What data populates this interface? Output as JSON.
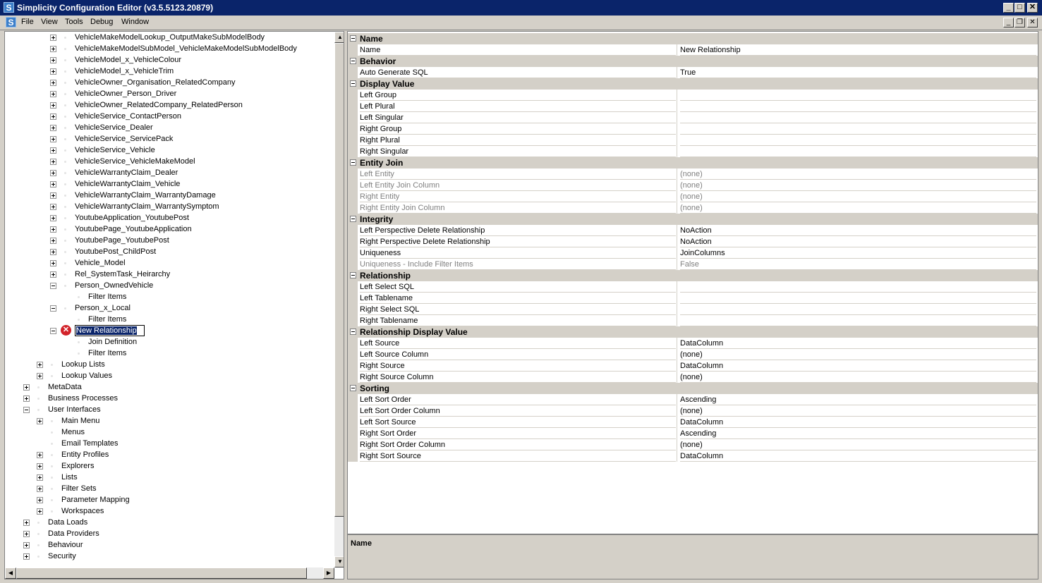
{
  "window": {
    "title": "Simplicity Configuration Editor (v3.5.5123.20879)",
    "minimize": "_",
    "maximize": "□",
    "close": "✕"
  },
  "menu": {
    "items": [
      "File",
      "View",
      "Tools",
      "Debug",
      "Window"
    ]
  },
  "tree": {
    "nodes": [
      {
        "label": "VehicleMakeModelLookup_OutputMakeSubModelBody",
        "level": 3,
        "exp": "plus"
      },
      {
        "label": "VehicleMakeModelSubModel_VehicleMakeModelSubModelBody",
        "level": 3,
        "exp": "plus"
      },
      {
        "label": "VehicleModel_x_VehicleColour",
        "level": 3,
        "exp": "plus"
      },
      {
        "label": "VehicleModel_x_VehicleTrim",
        "level": 3,
        "exp": "plus"
      },
      {
        "label": "VehicleOwner_Organisation_RelatedCompany",
        "level": 3,
        "exp": "plus"
      },
      {
        "label": "VehicleOwner_Person_Driver",
        "level": 3,
        "exp": "plus"
      },
      {
        "label": "VehicleOwner_RelatedCompany_RelatedPerson",
        "level": 3,
        "exp": "plus"
      },
      {
        "label": "VehicleService_ContactPerson",
        "level": 3,
        "exp": "plus"
      },
      {
        "label": "VehicleService_Dealer",
        "level": 3,
        "exp": "plus"
      },
      {
        "label": "VehicleService_ServicePack",
        "level": 3,
        "exp": "plus"
      },
      {
        "label": "VehicleService_Vehicle",
        "level": 3,
        "exp": "plus"
      },
      {
        "label": "VehicleService_VehicleMakeModel",
        "level": 3,
        "exp": "plus"
      },
      {
        "label": "VehicleWarrantyClaim_Dealer",
        "level": 3,
        "exp": "plus"
      },
      {
        "label": "VehicleWarrantyClaim_Vehicle",
        "level": 3,
        "exp": "plus"
      },
      {
        "label": "VehicleWarrantyClaim_WarrantyDamage",
        "level": 3,
        "exp": "plus"
      },
      {
        "label": "VehicleWarrantyClaim_WarrantySymptom",
        "level": 3,
        "exp": "plus"
      },
      {
        "label": "YoutubeApplication_YoutubePost",
        "level": 3,
        "exp": "plus"
      },
      {
        "label": "YoutubePage_YoutubeApplication",
        "level": 3,
        "exp": "plus"
      },
      {
        "label": "YoutubePage_YoutubePost",
        "level": 3,
        "exp": "plus"
      },
      {
        "label": "YoutubePost_ChildPost",
        "level": 3,
        "exp": "plus"
      },
      {
        "label": "Vehicle_Model",
        "level": 3,
        "exp": "plus"
      },
      {
        "label": "Rel_SystemTask_Heirarchy",
        "level": 3,
        "exp": "plus"
      },
      {
        "label": "Person_OwnedVehicle",
        "level": 3,
        "exp": "minus"
      },
      {
        "label": "Filter Items",
        "level": 4,
        "exp": "none"
      },
      {
        "label": "Person_x_Local",
        "level": 3,
        "exp": "minus"
      },
      {
        "label": "Filter Items",
        "level": 4,
        "exp": "none"
      },
      {
        "label": "New Relationship",
        "level": 3,
        "exp": "minus",
        "error": true,
        "editing": true
      },
      {
        "label": "Join Definition",
        "level": 4,
        "exp": "none"
      },
      {
        "label": "Filter Items",
        "level": 4,
        "exp": "none"
      },
      {
        "label": "Lookup Lists",
        "level": 2,
        "exp": "plus"
      },
      {
        "label": "Lookup Values",
        "level": 2,
        "exp": "plus"
      },
      {
        "label": "MetaData",
        "level": 1,
        "exp": "plus"
      },
      {
        "label": "Business Processes",
        "level": 1,
        "exp": "plus"
      },
      {
        "label": "User Interfaces",
        "level": 1,
        "exp": "minus"
      },
      {
        "label": "Main Menu",
        "level": 2,
        "exp": "plus"
      },
      {
        "label": "Menus",
        "level": 2,
        "exp": "none"
      },
      {
        "label": "Email Templates",
        "level": 2,
        "exp": "none"
      },
      {
        "label": "Entity Profiles",
        "level": 2,
        "exp": "plus"
      },
      {
        "label": "Explorers",
        "level": 2,
        "exp": "plus"
      },
      {
        "label": "Lists",
        "level": 2,
        "exp": "plus"
      },
      {
        "label": "Filter Sets",
        "level": 2,
        "exp": "plus"
      },
      {
        "label": "Parameter Mapping",
        "level": 2,
        "exp": "plus"
      },
      {
        "label": "Workspaces",
        "level": 2,
        "exp": "plus"
      },
      {
        "label": "Data Loads",
        "level": 1,
        "exp": "plus"
      },
      {
        "label": "Data Providers",
        "level": 1,
        "exp": "plus"
      },
      {
        "label": "Behaviour",
        "level": 1,
        "exp": "plus"
      },
      {
        "label": "Security",
        "level": 1,
        "exp": "plus"
      }
    ]
  },
  "properties": {
    "rows": [
      {
        "type": "cat",
        "label": "Name"
      },
      {
        "type": "prop",
        "name": "Name",
        "value": "New Relationship"
      },
      {
        "type": "cat",
        "label": "Behavior"
      },
      {
        "type": "prop",
        "name": "Auto Generate SQL",
        "value": "True"
      },
      {
        "type": "cat",
        "label": "Display Value"
      },
      {
        "type": "prop",
        "name": "Left Group",
        "value": ""
      },
      {
        "type": "prop",
        "name": "Left Plural",
        "value": ""
      },
      {
        "type": "prop",
        "name": "Left Singular",
        "value": ""
      },
      {
        "type": "prop",
        "name": "Right Group",
        "value": ""
      },
      {
        "type": "prop",
        "name": "Right Plural",
        "value": ""
      },
      {
        "type": "prop",
        "name": "Right Singular",
        "value": ""
      },
      {
        "type": "cat",
        "label": "Entity Join"
      },
      {
        "type": "prop",
        "name": "Left Entity",
        "value": "(none)",
        "disabled": true
      },
      {
        "type": "prop",
        "name": "Left Entity Join Column",
        "value": "(none)",
        "disabled": true
      },
      {
        "type": "prop",
        "name": "Right Entity",
        "value": "(none)",
        "disabled": true
      },
      {
        "type": "prop",
        "name": "Right Entity Join Column",
        "value": "(none)",
        "disabled": true
      },
      {
        "type": "cat",
        "label": "Integrity"
      },
      {
        "type": "prop",
        "name": "Left Perspective Delete Relationship",
        "value": "NoAction"
      },
      {
        "type": "prop",
        "name": "Right Perspective Delete Relationship",
        "value": "NoAction"
      },
      {
        "type": "prop",
        "name": "Uniqueness",
        "value": "JoinColumns"
      },
      {
        "type": "prop",
        "name": "Uniqueness - Include Filter Items",
        "value": "False",
        "disabled": true
      },
      {
        "type": "cat",
        "label": "Relationship"
      },
      {
        "type": "prop",
        "name": "Left Select SQL",
        "value": ""
      },
      {
        "type": "prop",
        "name": "Left Tablename",
        "value": ""
      },
      {
        "type": "prop",
        "name": "Right Select SQL",
        "value": ""
      },
      {
        "type": "prop",
        "name": "Right Tablename",
        "value": ""
      },
      {
        "type": "cat",
        "label": "Relationship Display Value"
      },
      {
        "type": "prop",
        "name": "Left Source",
        "value": "DataColumn"
      },
      {
        "type": "prop",
        "name": "Left Source Column",
        "value": "(none)"
      },
      {
        "type": "prop",
        "name": "Right Source",
        "value": "DataColumn"
      },
      {
        "type": "prop",
        "name": "Right Source Column",
        "value": "(none)"
      },
      {
        "type": "cat",
        "label": "Sorting"
      },
      {
        "type": "prop",
        "name": "Left Sort Order",
        "value": "Ascending"
      },
      {
        "type": "prop",
        "name": "Left Sort Order Column",
        "value": "(none)"
      },
      {
        "type": "prop",
        "name": "Left Sort Source",
        "value": "DataColumn"
      },
      {
        "type": "prop",
        "name": "Right Sort Order",
        "value": "Ascending"
      },
      {
        "type": "prop",
        "name": "Right Sort Order Column",
        "value": "(none)"
      },
      {
        "type": "prop",
        "name": "Right Sort Source",
        "value": "DataColumn"
      }
    ]
  },
  "description": {
    "title": "Name"
  }
}
